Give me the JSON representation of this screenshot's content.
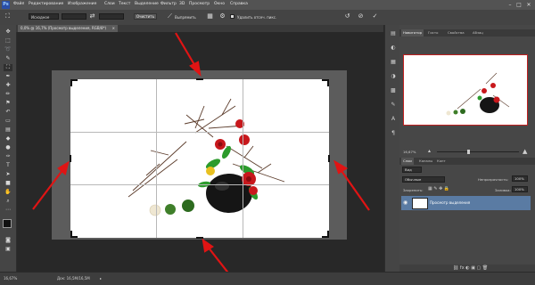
{
  "app": {
    "logo": "Ps",
    "menu": [
      "Файл",
      "Редактирование",
      "Изображение",
      "Слои",
      "Текст",
      "Выделение",
      "Фильтр",
      "3D",
      "Просмотр",
      "Окно",
      "Справка"
    ],
    "window_controls": [
      "–",
      "□",
      "✕"
    ]
  },
  "options": {
    "ratio_select": "Исходное",
    "swap_icon": "⇄",
    "clear_button": "Очистить",
    "straighten_label": "Выпрямить",
    "view_icon": "▦",
    "gear_icon": "⚙",
    "delete_checkbox_label": "Удалить отсеч. пикс.",
    "reset_icon": "↺",
    "cancel_icon": "⊘",
    "commit_icon": "✓"
  },
  "document": {
    "tab_title": "0,0% @ 16,7% (Просмотр выделения, RGB/8*)",
    "tab_close": "×"
  },
  "status": {
    "zoom": "16,67%",
    "doc_size": "Док: 16,5M/16,5M",
    "arrow": "▸"
  },
  "panels": {
    "nav_tabs": [
      "Навигатор",
      "Гисто",
      "Свойства",
      "Абзац"
    ],
    "nav_zoom": "16,67%",
    "layer_tabs": [
      "Слои",
      "Каналы",
      "Конт"
    ],
    "kind_select": "Вид",
    "blend_select": "Обычные",
    "opacity_label": "Непрозрачность:",
    "opacity_value": "100%",
    "lock_label": "Закрепить:",
    "fill_label": "Заливка:",
    "fill_value": "100%",
    "layer_name": "Просмотр выделения"
  },
  "colors": {
    "accent_arrow": "#e01414",
    "layer_selected": "#5a7ba3",
    "panel_bg": "#474747"
  }
}
